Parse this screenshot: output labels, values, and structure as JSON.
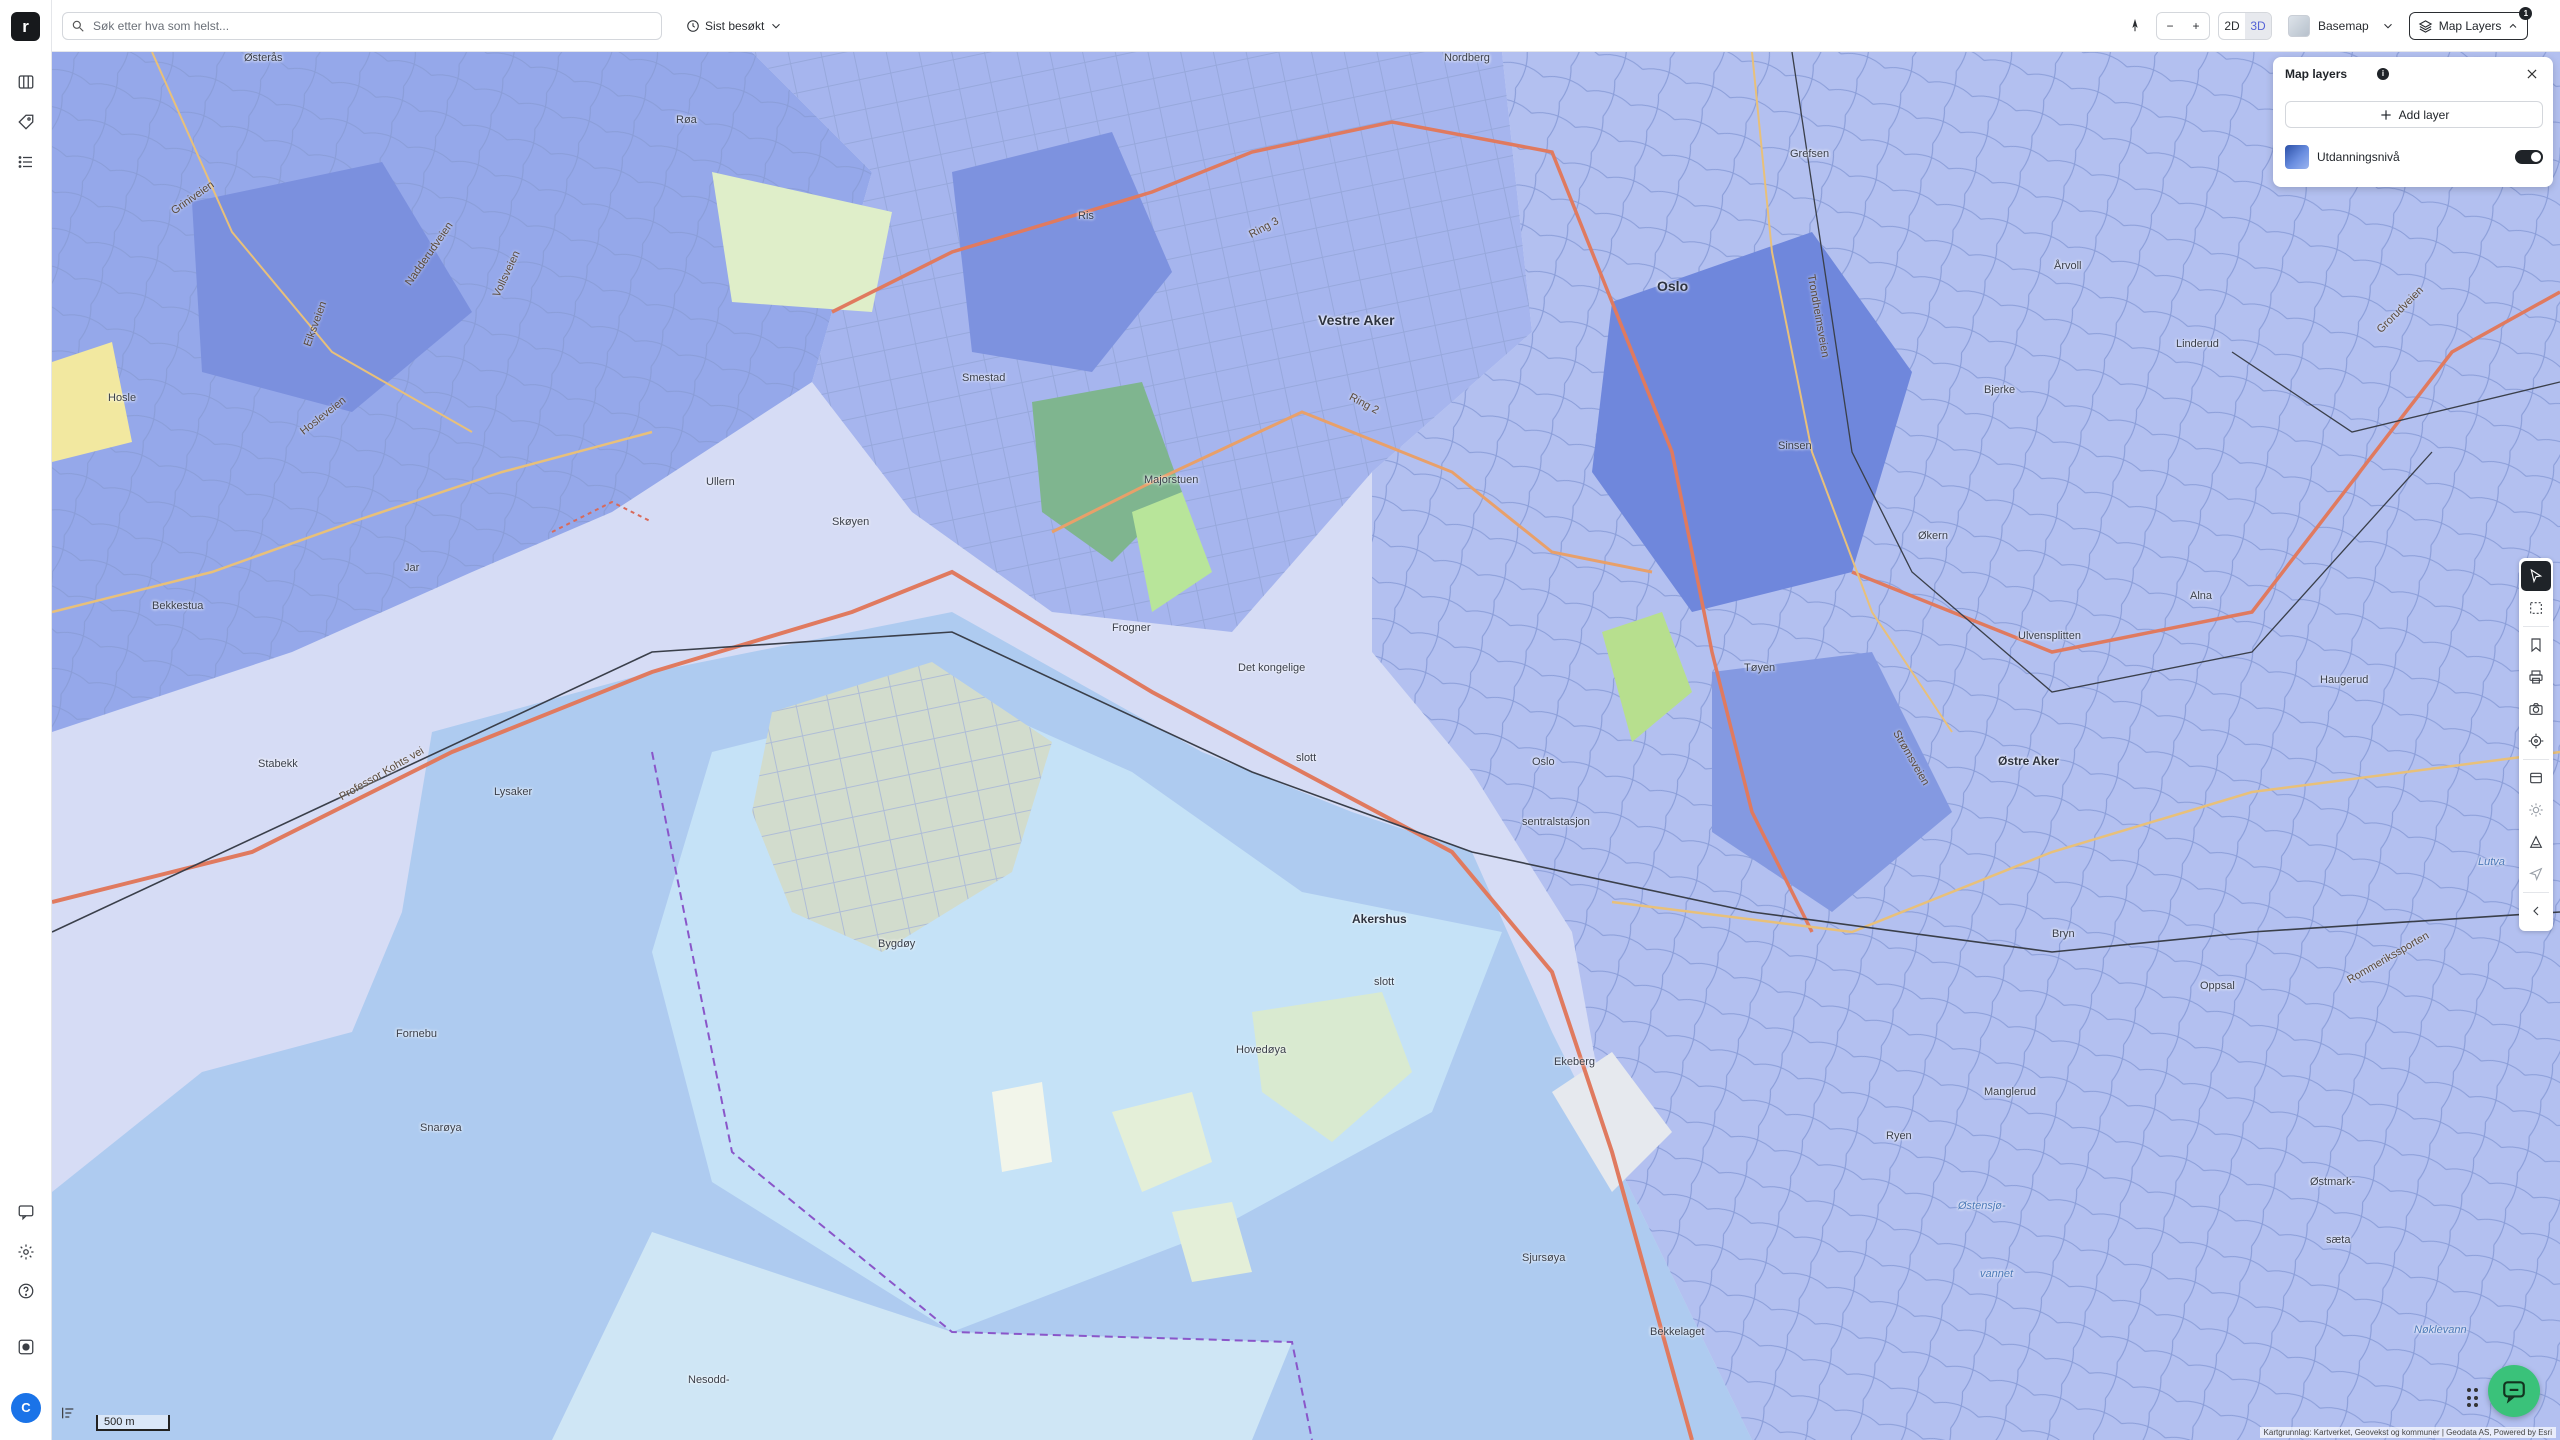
{
  "app": {
    "logo_letter": "r",
    "avatar_initial": "C"
  },
  "topbar": {
    "search_placeholder": "Søk etter hva som helst...",
    "recent_label": "Sist besøkt",
    "zoom_out": "−",
    "zoom_in": "+",
    "view_2d": "2D",
    "view_3d": "3D",
    "active_view": "3D",
    "basemap_label": "Basemap",
    "map_layers_label": "Map Layers",
    "map_layers_count": "1"
  },
  "layers_panel": {
    "title": "Map layers",
    "info": "i",
    "add_layer_label": "Add layer",
    "layers": [
      {
        "name": "Utdanningsnivå",
        "enabled": true
      }
    ]
  },
  "map": {
    "scale_label": "500 m",
    "attribution": "Kartgrunnlag: Kartverket, Geovekst og kommuner | Geodata AS, Powered by Esri",
    "places": [
      {
        "name": "Oslo",
        "big": true
      },
      {
        "name": "Vestre Aker",
        "big": true
      },
      {
        "name": "Ris"
      },
      {
        "name": "Røa"
      },
      {
        "name": "Nordberg"
      },
      {
        "name": "Grefsen"
      },
      {
        "name": "Smestad"
      },
      {
        "name": "Ullern"
      },
      {
        "name": "Skøyen"
      },
      {
        "name": "Majorstuen"
      },
      {
        "name": "Frogner"
      },
      {
        "name": "Det kongelige"
      },
      {
        "name": "slott"
      },
      {
        "name": "Oslo"
      },
      {
        "name": "sentralstasjon"
      },
      {
        "name": "Tøyen"
      },
      {
        "name": "Sinsen"
      },
      {
        "name": "Økern"
      },
      {
        "name": "Bjerke"
      },
      {
        "name": "Linderud"
      },
      {
        "name": "Årvoll"
      },
      {
        "name": "Alna"
      },
      {
        "name": "Ulvensplitten"
      },
      {
        "name": "Haugerud"
      },
      {
        "name": "Østre Aker"
      },
      {
        "name": "Bryn"
      },
      {
        "name": "Oppsal"
      },
      {
        "name": "Manglerud"
      },
      {
        "name": "Ryen"
      },
      {
        "name": "Ekeberg"
      },
      {
        "name": "Akershus"
      },
      {
        "name": "slott"
      },
      {
        "name": "Hovedøya"
      },
      {
        "name": "Bygdøy"
      },
      {
        "name": "Fornebu"
      },
      {
        "name": "Snarøya"
      },
      {
        "name": "Lysaker"
      },
      {
        "name": "Stabekk"
      },
      {
        "name": "Bekkestua"
      },
      {
        "name": "Jar"
      },
      {
        "name": "Hosle"
      },
      {
        "name": "Østerås"
      },
      {
        "name": "Sjursøya"
      },
      {
        "name": "Nesodd-"
      },
      {
        "name": "Bekkelaget"
      },
      {
        "name": "Østmark-"
      },
      {
        "name": "sæta"
      },
      {
        "name": "Nøklevann"
      },
      {
        "name": "Lutva"
      },
      {
        "name": "Østensjø-"
      },
      {
        "name": "vannet"
      }
    ],
    "roads": [
      "Ring 3",
      "Ring 2",
      "Griniveien",
      "Professor Kohts vei",
      "Hosleveien",
      "Nadderudveien",
      "Vollsveien",
      "Eiksveien",
      "Trondheimsveien",
      "Strømsveien",
      "Grorudveien",
      "Rommerikssporten"
    ]
  },
  "colors": {
    "accent": "#5563d6",
    "layer_dark": "#5b76d9",
    "layer_mid": "#93a8ea",
    "layer_light": "#c3cdf3",
    "water": "#aecbf0",
    "park": "#c8e6b0",
    "road_major": "#e07a5f",
    "road_minor": "#e8c07a",
    "chat": "#3ac27a"
  }
}
